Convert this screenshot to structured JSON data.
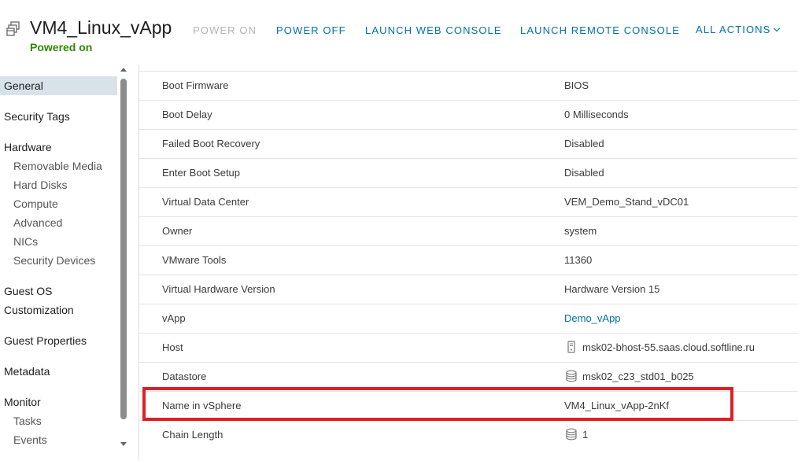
{
  "header": {
    "vm_name": "VM4_Linux_vApp",
    "status": "Powered on",
    "actions": {
      "power_on": "POWER ON",
      "power_off": "POWER OFF",
      "launch_web_console": "LAUNCH WEB CONSOLE",
      "launch_remote_console": "LAUNCH REMOTE CONSOLE",
      "all_actions": "ALL ACTIONS"
    }
  },
  "sidebar": {
    "general": "General",
    "security_tags": "Security Tags",
    "hardware": "Hardware",
    "removable_media": "Removable Media",
    "hard_disks": "Hard Disks",
    "compute": "Compute",
    "advanced": "Advanced",
    "nics": "NICs",
    "security_devices": "Security Devices",
    "guest_os_line1": "Guest OS",
    "guest_os_line2": "Customization",
    "guest_properties": "Guest Properties",
    "metadata": "Metadata",
    "monitor": "Monitor",
    "tasks": "Tasks",
    "events": "Events"
  },
  "details": {
    "boot_firmware": {
      "label": "Boot Firmware",
      "value": "BIOS"
    },
    "boot_delay": {
      "label": "Boot Delay",
      "value": "0 Milliseconds"
    },
    "failed_boot_recovery": {
      "label": "Failed Boot Recovery",
      "value": "Disabled"
    },
    "enter_boot_setup": {
      "label": "Enter Boot Setup",
      "value": "Disabled"
    },
    "virtual_data_center": {
      "label": "Virtual Data Center",
      "value": "VEM_Demo_Stand_vDC01"
    },
    "owner": {
      "label": "Owner",
      "value": "system"
    },
    "vmware_tools": {
      "label": "VMware Tools",
      "value": "11360"
    },
    "virtual_hardware_version": {
      "label": "Virtual Hardware Version",
      "value": "Hardware Version 15"
    },
    "vapp": {
      "label": "vApp",
      "value": "Demo_vApp"
    },
    "host": {
      "label": "Host",
      "value": "msk02-bhost-55.saas.cloud.softline.ru",
      "icon": "server-icon"
    },
    "datastore": {
      "label": "Datastore",
      "value": "msk02_c23_std01_b025",
      "icon": "datastore-icon"
    },
    "name_in_vsphere": {
      "label": "Name in vSphere",
      "value": "VM4_Linux_vApp-2nKf"
    },
    "chain_length": {
      "label": "Chain Length",
      "value": "1",
      "icon": "disk-stack-icon"
    }
  },
  "colors": {
    "accent": "#0072a3",
    "status": "#318700",
    "highlight": "#dd1f26"
  }
}
